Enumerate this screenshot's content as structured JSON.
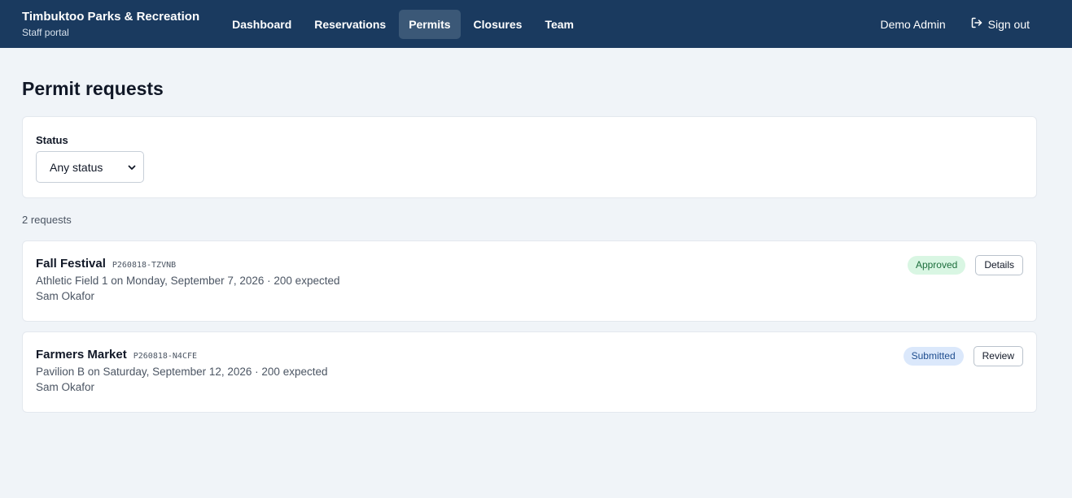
{
  "header": {
    "brand_title": "Timbuktoo Parks & Recreation",
    "brand_subtitle": "Staff portal",
    "nav": [
      {
        "label": "Dashboard",
        "active": false
      },
      {
        "label": "Reservations",
        "active": false
      },
      {
        "label": "Permits",
        "active": true
      },
      {
        "label": "Closures",
        "active": false
      },
      {
        "label": "Team",
        "active": false
      }
    ],
    "user_name": "Demo Admin",
    "signout_label": "Sign out",
    "signout_icon": "sign-out-icon"
  },
  "page": {
    "title": "Permit requests"
  },
  "filter": {
    "label": "Status",
    "selected": "Any status",
    "icon": "chevron-down-icon"
  },
  "results": {
    "count_text": "2 requests"
  },
  "requests": [
    {
      "title": "Fall Festival",
      "code": "P260818-TZVNB",
      "details": "Athletic Field 1 on Monday, September 7, 2026 · 200 expected",
      "owner": "Sam Okafor",
      "status": "Approved",
      "action": "Details"
    },
    {
      "title": "Farmers Market",
      "code": "P260818-N4CFE",
      "details": "Pavilion B on Saturday, September 12, 2026 · 200 expected",
      "owner": "Sam Okafor",
      "status": "Submitted",
      "action": "Review"
    }
  ],
  "colors": {
    "header_bg": "#1a3a5f",
    "page_bg": "#f0f4f8",
    "approved_bg": "#d9f6e3",
    "submitted_bg": "#dbe8fb"
  }
}
